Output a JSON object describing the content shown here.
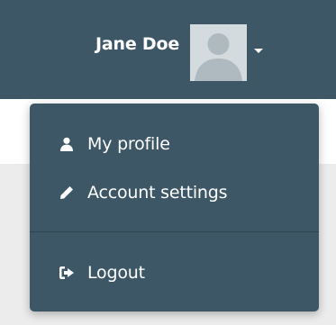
{
  "header": {
    "username": "Jane Doe",
    "avatar_icon": "user-silhouette-icon",
    "caret_icon": "caret-down-icon"
  },
  "dropdown": {
    "items": [
      {
        "label": "My profile",
        "icon": "user-icon"
      },
      {
        "label": "Account settings",
        "icon": "pencil-icon"
      },
      {
        "label": "Logout",
        "icon": "sign-out-icon"
      }
    ]
  },
  "colors": {
    "header_bg": "#3e5766",
    "menu_bg": "#3e5766",
    "text": "#ffffff",
    "page_bg": "#ececec"
  }
}
